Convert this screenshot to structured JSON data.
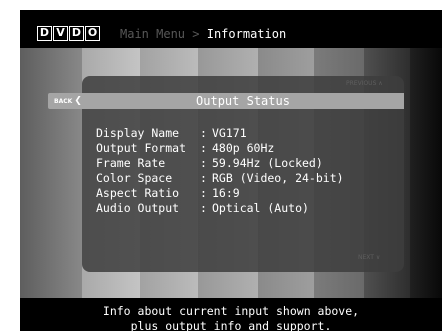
{
  "header": {
    "logo_letters": [
      "D",
      "V",
      "D",
      "O"
    ],
    "breadcrumb": {
      "parent": "Main Menu",
      "separator": ">",
      "current": "Information"
    }
  },
  "panel": {
    "prev_link": "PREVIOUS ∧",
    "next_link": "NEXT ∨",
    "title": "Output Status",
    "back_button": "BACK",
    "back_arrow": "❮",
    "separator": ":",
    "rows": [
      {
        "label": "Display Name",
        "value": "VG171"
      },
      {
        "label": "Output Format",
        "value": "480p 60Hz"
      },
      {
        "label": "Frame Rate",
        "value": "59.94Hz (Locked)"
      },
      {
        "label": "Color Space",
        "value": "RGB (Video, 24-bit)"
      },
      {
        "label": "Aspect Ratio",
        "value": "16:9"
      },
      {
        "label": "Audio Output",
        "value": "Optical (Auto)"
      }
    ]
  },
  "footer": {
    "line1": "Info about current input shown above,",
    "line2": "plus output info and support."
  }
}
